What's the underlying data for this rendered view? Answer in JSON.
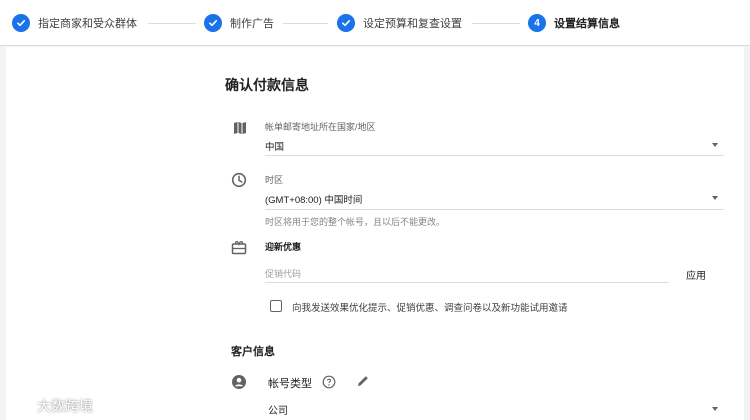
{
  "stepper": {
    "steps": [
      {
        "label": "指定商家和受众群体",
        "state": "done"
      },
      {
        "label": "制作广告",
        "state": "done"
      },
      {
        "label": "设定预算和复查设置",
        "state": "done"
      },
      {
        "label": "设置结算信息",
        "state": "active",
        "number": "4"
      }
    ]
  },
  "payment": {
    "title": "确认付款信息",
    "country": {
      "label": "帐单邮寄地址所在国家/地区",
      "value": "中国",
      "icon": "map-icon"
    },
    "timezone": {
      "label": "时区",
      "value": "(GMT+08:00) 中国时间",
      "helper": "时区将用于您的整个帐号，且以后不能更改。",
      "icon": "clock-icon"
    },
    "promo": {
      "label": "迎新优惠",
      "placeholder": "促销代码",
      "apply_label": "应用",
      "icon": "gift-icon"
    },
    "opt_in": {
      "label": "向我发送效果优化提示、促销优惠、调查问卷以及新功能试用邀请",
      "checked": false
    }
  },
  "customer": {
    "title": "客户信息",
    "account_type": {
      "label": "帐号类型",
      "value": "公司",
      "icon": "account-circle-icon"
    }
  },
  "watermark": {
    "text": "大数跨境"
  },
  "colors": {
    "accent": "#1a73e8",
    "background": "#f1f3f4",
    "card": "#ffffff",
    "divider": "#dadce0"
  }
}
